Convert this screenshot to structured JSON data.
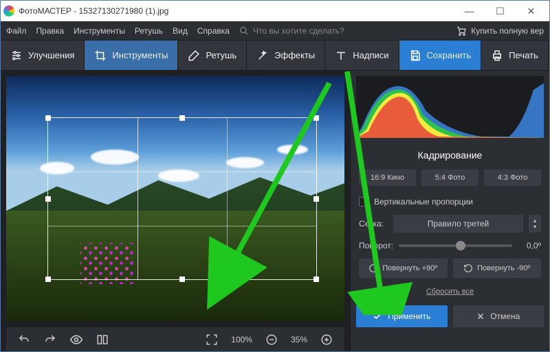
{
  "window": {
    "title": "ФотоМАСТЕР - 15327130271980 (1).jpg",
    "minimize": "—",
    "maximize": "☐",
    "close": "✕"
  },
  "menu": {
    "file": "Файл",
    "edit": "Правка",
    "tools": "Инструменты",
    "retouch": "Ретушь",
    "view": "Вид",
    "help": "Справка",
    "search_placeholder": "Что вы хотите сделать?",
    "buy": "Купить полную вер"
  },
  "toolbar": {
    "enhance": "Улучшения",
    "tools": "Инструменты",
    "retouch": "Ретушь",
    "effects": "Эффекты",
    "captions": "Надписи",
    "save": "Сохранить",
    "print": "Печать"
  },
  "bottombar": {
    "zoom_fit": "100%",
    "zoom_level": "35%"
  },
  "panel": {
    "title": "Кадрирование",
    "preset_169": "16:9 Кино",
    "preset_54": "5:4 Фото",
    "preset_43": "4:3 Фото",
    "vertical_label": "Вертикальные пропорции",
    "grid_label": "Сетка:",
    "grid_value": "Правило третей",
    "rotate_label": "Поворот:",
    "rotate_value": "0,0º",
    "rotate_plus": "Повернуть +90º",
    "rotate_minus": "Повернуть -90º",
    "reset": "Сбросить все",
    "apply": "Применить",
    "cancel": "Отмена"
  }
}
